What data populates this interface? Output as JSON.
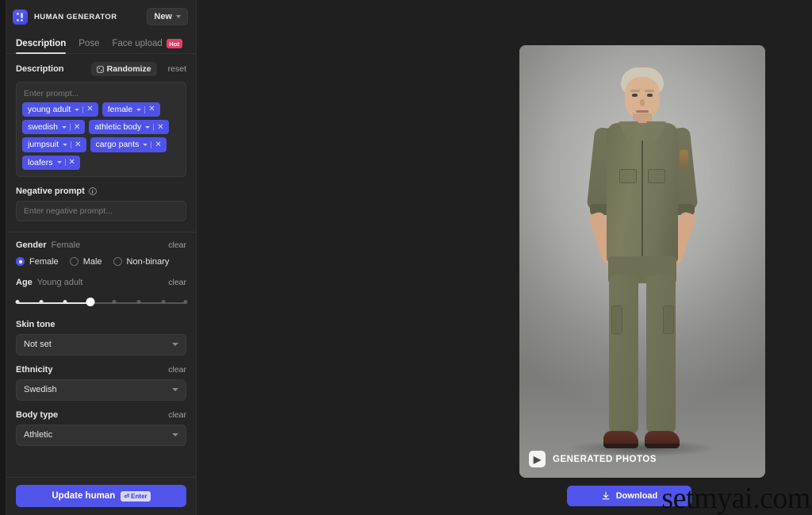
{
  "app": {
    "brand": "HUMAN GENERATOR",
    "logo_icon": "grid-dots-icon",
    "new_button": "New",
    "new_chevron_icon": "chevron-down-icon"
  },
  "tabs": [
    {
      "label": "Description",
      "active": true,
      "badge": null
    },
    {
      "label": "Pose",
      "active": false,
      "badge": null
    },
    {
      "label": "Face upload",
      "active": false,
      "badge": "Hot"
    }
  ],
  "description": {
    "title": "Description",
    "randomize_label": "Randomize",
    "randomize_icon": "dice-icon",
    "reset_label": "reset",
    "prompt_placeholder": "Enter prompt...",
    "chips": [
      {
        "label": "young adult"
      },
      {
        "label": "female"
      },
      {
        "label": "swedish"
      },
      {
        "label": "athletic body"
      },
      {
        "label": "jumpsuit"
      },
      {
        "label": "cargo pants"
      },
      {
        "label": "loafers"
      }
    ],
    "chip_chevron_icon": "chevron-down-icon",
    "chip_remove_icon": "close-icon"
  },
  "negative_prompt": {
    "label": "Negative prompt",
    "info_icon": "info-icon",
    "placeholder": "Enter negative prompt...",
    "value": ""
  },
  "gender": {
    "label": "Gender",
    "value": "Female",
    "clear": "clear",
    "options": [
      {
        "label": "Female",
        "selected": true
      },
      {
        "label": "Male",
        "selected": false
      },
      {
        "label": "Non-binary",
        "selected": false
      }
    ]
  },
  "age": {
    "label": "Age",
    "value": "Young adult",
    "clear": "clear",
    "steps": 8,
    "selected_index": 3
  },
  "skin_tone": {
    "label": "Skin tone",
    "value": "Not set",
    "chevron_icon": "chevron-down-icon"
  },
  "ethnicity": {
    "label": "Ethnicity",
    "value": "Swedish",
    "clear": "clear",
    "chevron_icon": "chevron-down-icon"
  },
  "body_type": {
    "label": "Body type",
    "value": "Athletic",
    "clear": "clear",
    "chevron_icon": "chevron-down-icon"
  },
  "footer": {
    "update_label": "Update human",
    "enter_badge": "⏎ Enter"
  },
  "preview": {
    "watermark_logo": "▶",
    "watermark_text": "GENERATED PHOTOS",
    "download_label": "Download",
    "download_icon": "download-icon"
  },
  "site_watermark": "setmyai.com",
  "colors": {
    "accent": "#5154ea",
    "chip": "#4f52e8",
    "hot_badge": "#ef3b63",
    "panel_bg": "#262626",
    "main_bg": "#1f1f1f"
  }
}
